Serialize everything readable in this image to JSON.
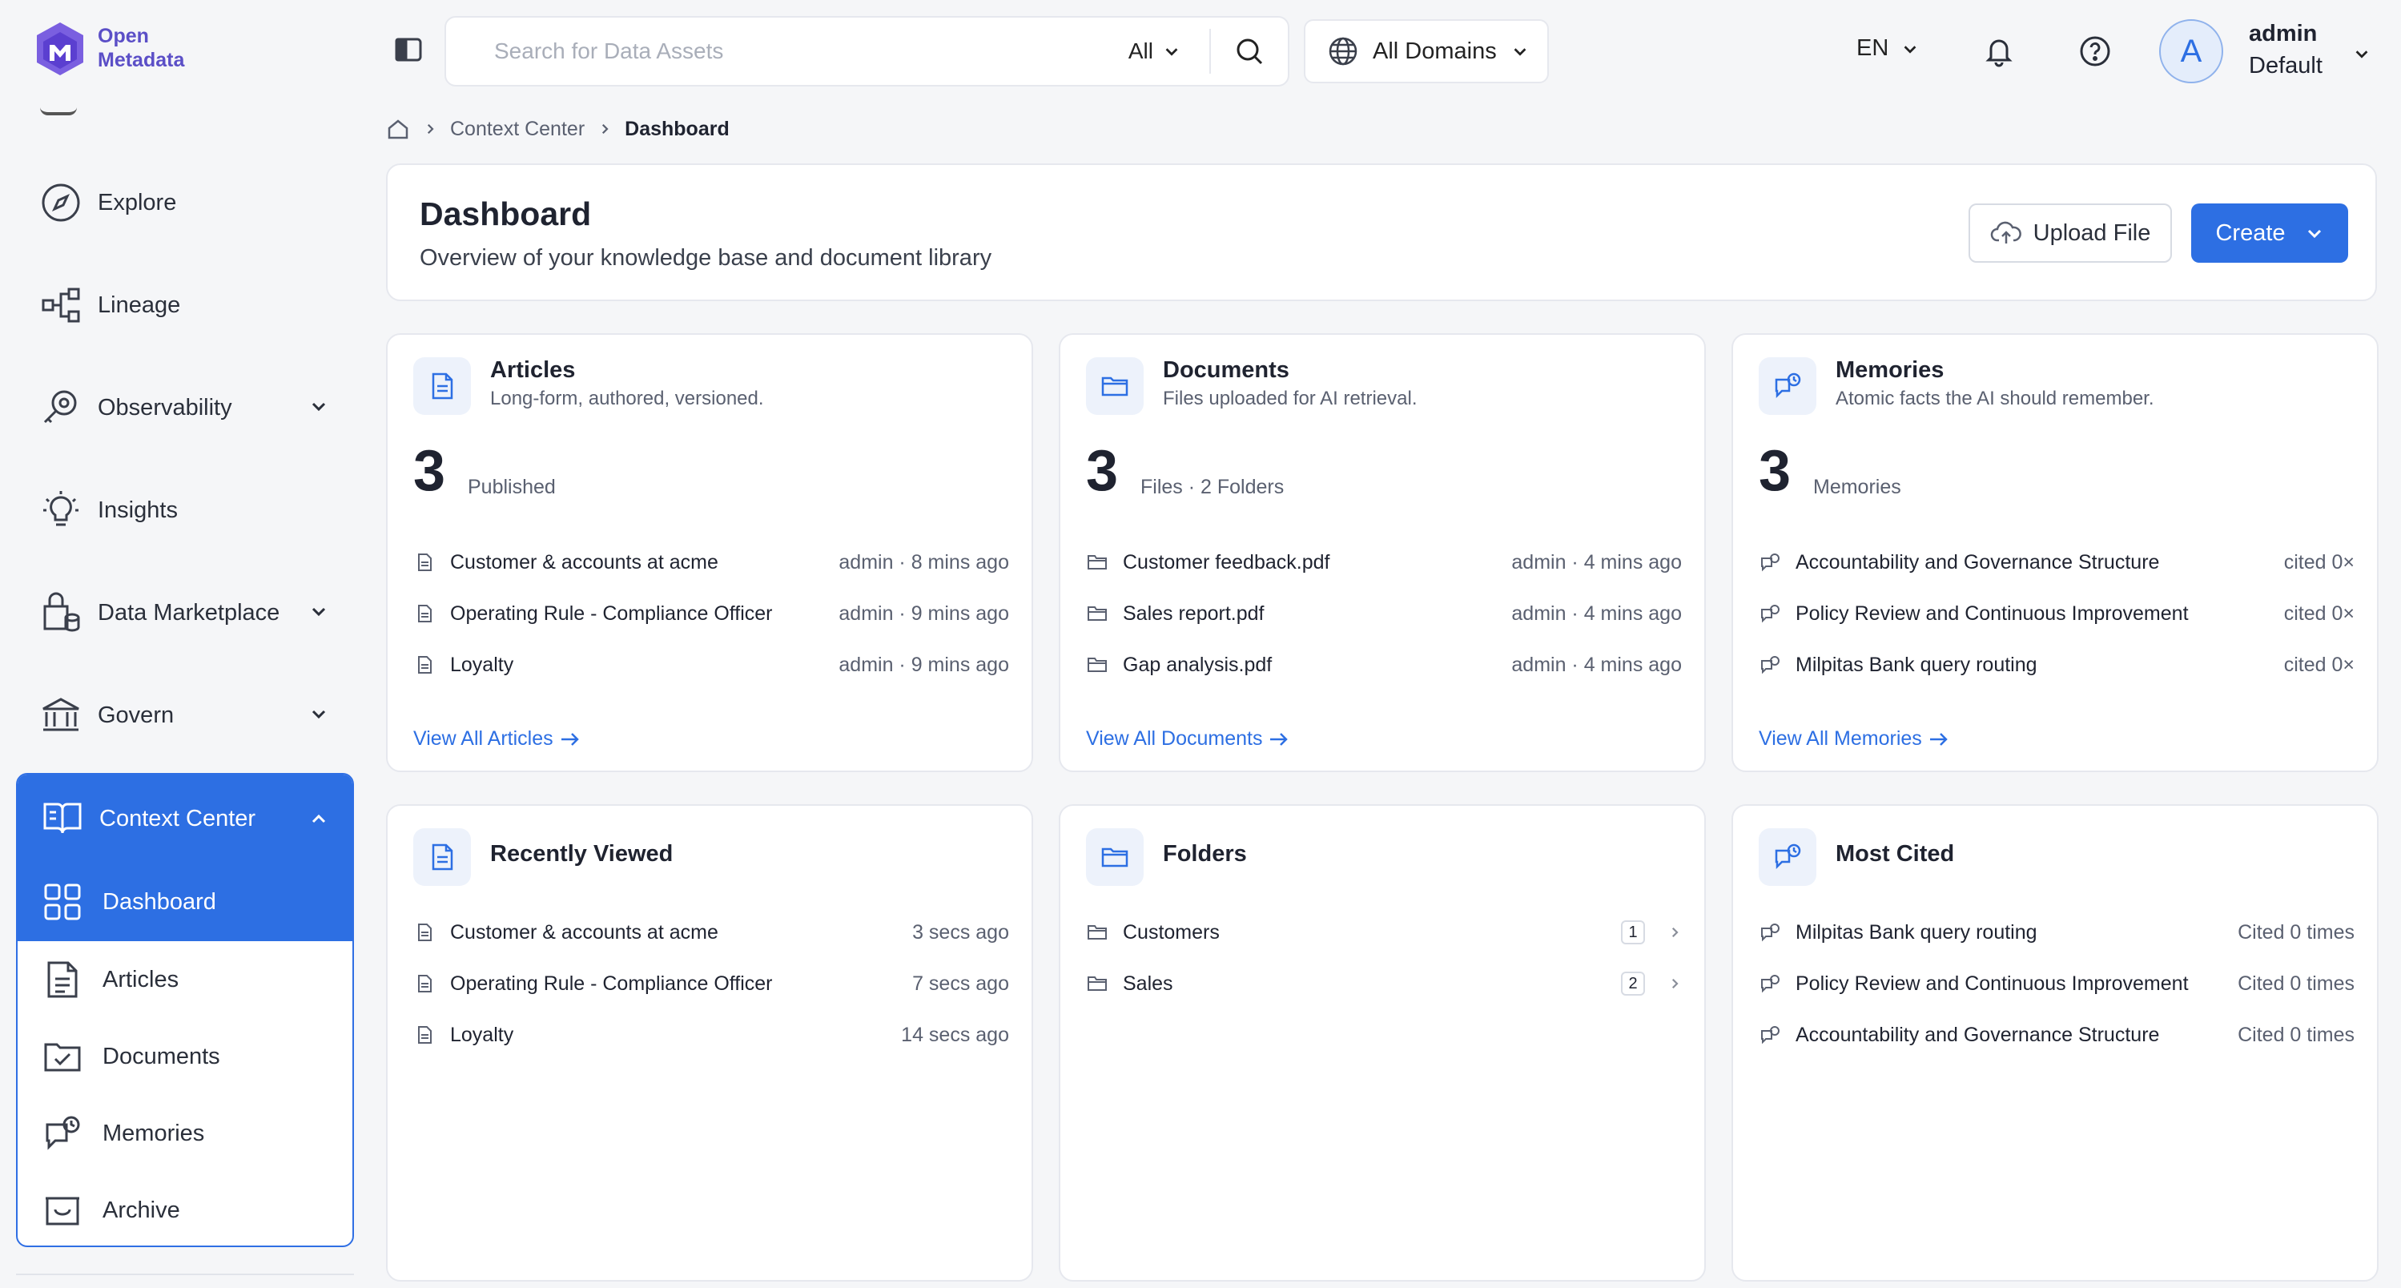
{
  "brand": {
    "line1": "Open",
    "line2": "Metadata",
    "color": "#5b4fc7"
  },
  "accent": "#2d6fe3",
  "sidebar": {
    "items": [
      {
        "label": "Explore",
        "icon": "compass-icon"
      },
      {
        "label": "Lineage",
        "icon": "lineage-icon"
      },
      {
        "label": "Observability",
        "icon": "observability-icon"
      },
      {
        "label": "Insights",
        "icon": "lightbulb-icon"
      },
      {
        "label": "Data Marketplace",
        "icon": "marketplace-icon"
      },
      {
        "label": "Govern",
        "icon": "bank-icon"
      }
    ],
    "context_center": {
      "label": "Context Center",
      "children": [
        {
          "label": "Dashboard",
          "icon": "grid-icon",
          "active": true
        },
        {
          "label": "Articles",
          "icon": "article-icon"
        },
        {
          "label": "Documents",
          "icon": "folder-check-icon"
        },
        {
          "label": "Memories",
          "icon": "memory-icon"
        },
        {
          "label": "Archive",
          "icon": "archive-icon"
        }
      ]
    }
  },
  "topbar": {
    "search_placeholder": "Search for Data Assets",
    "search_scope": "All",
    "domains": "All Domains",
    "language": "EN",
    "user": {
      "initial": "A",
      "name": "admin",
      "role": "Default"
    }
  },
  "breadcrumb": [
    "Context Center",
    "Dashboard"
  ],
  "header": {
    "title": "Dashboard",
    "subtitle": "Overview of your knowledge base and document library",
    "upload_label": "Upload File",
    "create_label": "Create"
  },
  "cards": {
    "articles": {
      "title": "Articles",
      "subtitle": "Long-form, authored, versioned.",
      "count": "3",
      "count_label": "Published",
      "rows": [
        {
          "label": "Customer & accounts at acme",
          "meta": "admin · 8 mins ago"
        },
        {
          "label": "Operating Rule - Compliance Officer",
          "meta": "admin · 9 mins ago"
        },
        {
          "label": "Loyalty",
          "meta": "admin · 9 mins ago"
        }
      ],
      "view_all": "View All Articles"
    },
    "documents": {
      "title": "Documents",
      "subtitle": "Files uploaded for AI retrieval.",
      "count": "3",
      "count_label": "Files · 2 Folders",
      "rows": [
        {
          "label": "Customer feedback.pdf",
          "meta": "admin · 4 mins ago"
        },
        {
          "label": "Sales report.pdf",
          "meta": "admin · 4 mins ago"
        },
        {
          "label": "Gap analysis.pdf",
          "meta": "admin · 4 mins ago"
        }
      ],
      "view_all": "View All Documents"
    },
    "memories": {
      "title": "Memories",
      "subtitle": "Atomic facts the AI should remember.",
      "count": "3",
      "count_label": "Memories",
      "rows": [
        {
          "label": "Accountability and Governance Structure",
          "meta": "cited 0×"
        },
        {
          "label": "Policy Review and Continuous Improvement",
          "meta": "cited 0×"
        },
        {
          "label": "Milpitas Bank query routing",
          "meta": "cited 0×"
        }
      ],
      "view_all": "View All Memories"
    },
    "recently_viewed": {
      "title": "Recently Viewed",
      "rows": [
        {
          "label": "Customer & accounts at acme",
          "meta": "3 secs ago"
        },
        {
          "label": "Operating Rule - Compliance Officer",
          "meta": "7 secs ago"
        },
        {
          "label": "Loyalty",
          "meta": "14 secs ago"
        }
      ]
    },
    "folders": {
      "title": "Folders",
      "rows": [
        {
          "label": "Customers",
          "count": "1"
        },
        {
          "label": "Sales",
          "count": "2"
        }
      ]
    },
    "most_cited": {
      "title": "Most Cited",
      "rows": [
        {
          "label": "Milpitas Bank query routing",
          "meta": "Cited 0 times"
        },
        {
          "label": "Policy Review and Continuous Improvement",
          "meta": "Cited 0 times"
        },
        {
          "label": "Accountability and Governance Structure",
          "meta": "Cited 0 times"
        }
      ]
    }
  }
}
